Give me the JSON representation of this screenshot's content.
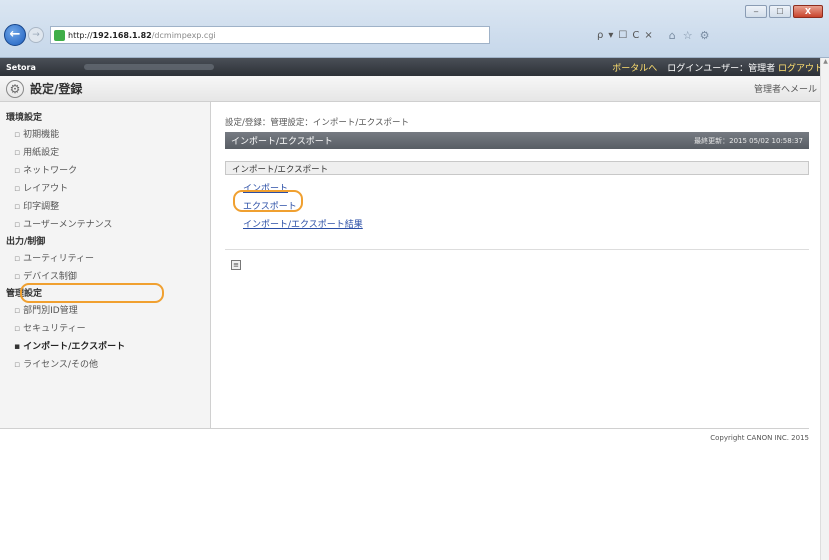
{
  "browser": {
    "url_host": "http://",
    "url_bold": "192.168.1.82",
    "url_rest": "/dcmimpexp.cgi",
    "addr_tools": [
      "ρ",
      "▾",
      "☐",
      "C",
      "×"
    ],
    "home_tools": [
      "⌂",
      "☆",
      "⚙"
    ],
    "win_buttons": [
      "‒",
      "☐",
      "X"
    ]
  },
  "topbar": {
    "brand": "Setora",
    "portal_link": "ポータルへ",
    "login_user": "ログインユーザー：管理者",
    "logout_link": "ログアウト"
  },
  "titlebar": {
    "title": "設定/登録",
    "mail_link": "管理者へメール"
  },
  "sidebar": {
    "sections": [
      {
        "label": "環境設定",
        "items": [
          "初期機能",
          "用紙設定",
          "ネットワーク",
          "レイアウト",
          "印字調整",
          "ユーザーメンテナンス"
        ]
      },
      {
        "label": "出力/制御",
        "items": [
          "ユーティリティー",
          "デバイス制御"
        ]
      },
      {
        "label": "管理設定",
        "items": [
          "部門別ID管理",
          "セキュリティー",
          "インポート/エクスポート",
          "ライセンス/その他"
        ]
      }
    ]
  },
  "main": {
    "breadcrumb": "設定/登録：管理設定：インポート/エクスポート",
    "heading": "インポート/エクスポート",
    "last_updated": "最終更新：2015 05/02 10:58:37",
    "section": "インポート/エクスポート",
    "links": [
      "インポート",
      "エクスポート",
      "インポート/エクスポート結果"
    ],
    "mini_icon": "≡"
  },
  "footer": {
    "copyright": "Copyright CANON INC. 2015"
  },
  "colors": {
    "highlight": "#f0a030",
    "link": "#2a4ea6",
    "topbar_bg": "#2d3137",
    "heading_bg": "#585d64"
  }
}
